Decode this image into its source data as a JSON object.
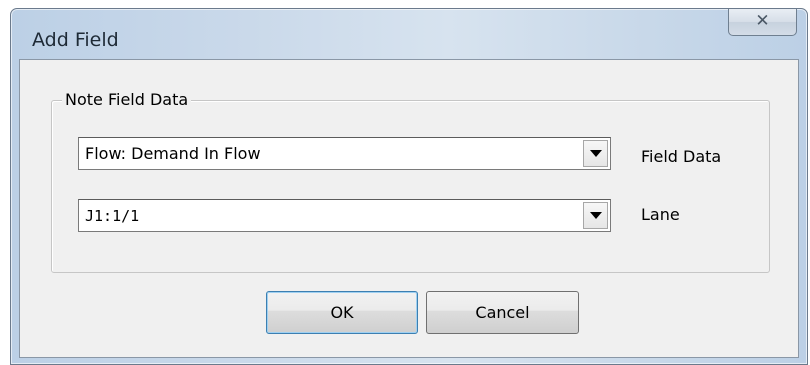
{
  "window": {
    "title": "Add Field",
    "close_glyph": "✕"
  },
  "group": {
    "legend": "Note Field Data"
  },
  "fields": [
    {
      "value": "Flow: Demand In Flow",
      "label": "Field Data"
    },
    {
      "value": "J1:1/1",
      "label": "Lane"
    }
  ],
  "buttons": {
    "ok_label": "OK",
    "cancel_label": "Cancel"
  },
  "icons": {
    "close": "close-icon",
    "dropdown": "chevron-down-icon"
  }
}
